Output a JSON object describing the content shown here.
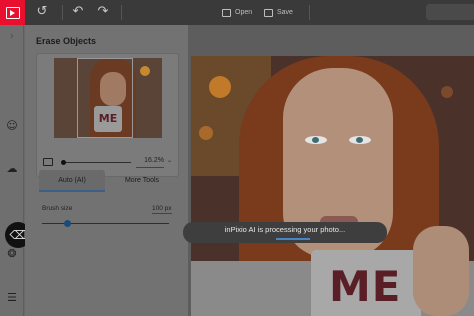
{
  "toolbar": {
    "logo_icon": "inpixio-logo",
    "open_label": "Open",
    "save_label": "Save"
  },
  "panel": {
    "title": "Erase Objects",
    "zoom_value": "16.2%",
    "tabs": [
      {
        "label": "Auto (AI)",
        "active": true
      },
      {
        "label": "More Tools",
        "active": false
      }
    ],
    "brush_label": "Brush size",
    "brush_value": "100 px",
    "brush_level_fraction": 0.2
  },
  "status": {
    "message": "inPixio AI is processing your photo..."
  },
  "photo": {
    "mug_text": "ME"
  },
  "colors": {
    "brand_red": "#e8102e",
    "accent_blue": "#3b5f88"
  }
}
